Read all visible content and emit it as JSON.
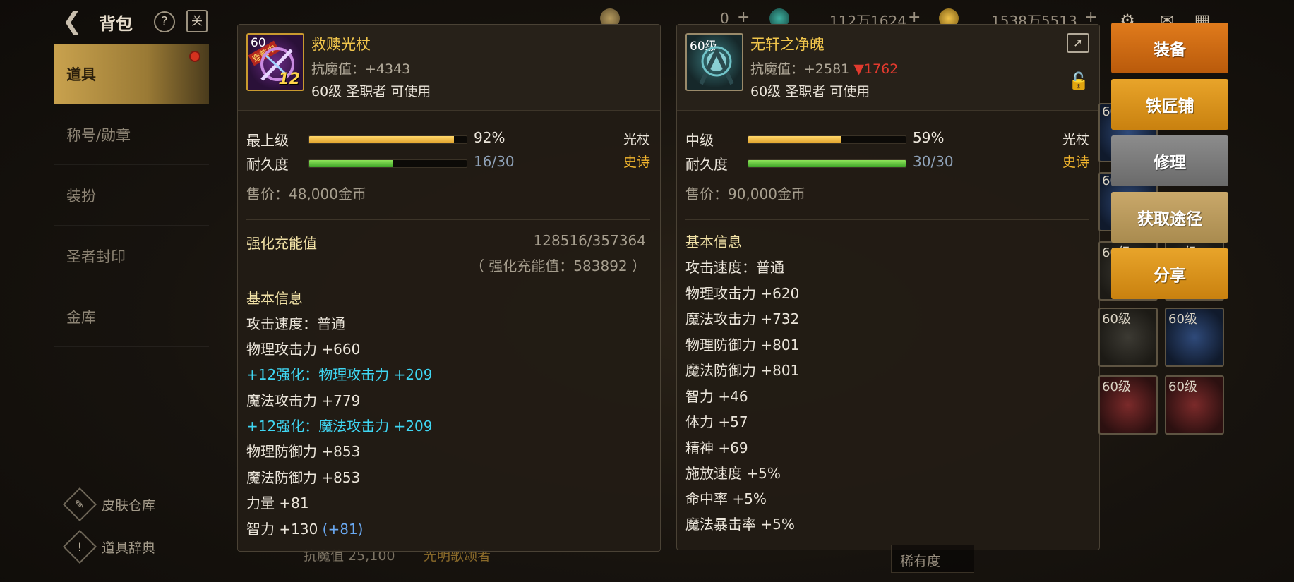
{
  "topbar": {
    "title": "背包",
    "help": "?",
    "book": "关",
    "currency": [
      {
        "value": "0",
        "plus": "+"
      },
      {
        "value": "112万1624",
        "plus": "+"
      },
      {
        "value": "1538万5513",
        "plus": "+"
      }
    ]
  },
  "sidebar": {
    "items": [
      {
        "label": "道具",
        "active": true
      },
      {
        "label": "称号/勋章"
      },
      {
        "label": "装扮"
      },
      {
        "label": "圣者封印"
      },
      {
        "label": "金库"
      }
    ],
    "bottom": [
      {
        "label": "皮肤仓库",
        "icon": "brush-icon"
      },
      {
        "label": "道具辞典",
        "icon": "book-icon"
      }
    ]
  },
  "background": {
    "mres_text": "抗魔值 25,100",
    "title_text": "光明歌颂者",
    "rarity_filter": "稀有度"
  },
  "left_card": {
    "level_tag": "60",
    "equipped_tag": "穿戴中",
    "enhance": "12",
    "name": "救赎光杖",
    "magic_resist": "抗魔值：+4343",
    "usable": "60级 圣职者 可使用",
    "grade_label": "最上级",
    "grade_pct_value": 0.92,
    "grade_pct": "92%",
    "type": "光杖",
    "rarity": "史诗",
    "durability_label": "耐久度",
    "durability_value": 0.533,
    "durability": "16/30",
    "price": "售价：48,000金币",
    "charge_label": "强化充能值",
    "charge_value": "128516/357364",
    "charge_total": "（ 强化充能值：583892 ）",
    "basic_info": "基本信息",
    "stats": [
      {
        "text": "攻击速度：普通",
        "style": "normal"
      },
      {
        "text": "物理攻击力 +660",
        "style": "normal"
      },
      {
        "text": "+12强化：物理攻击力 +209",
        "style": "cyan"
      },
      {
        "text": "魔法攻击力 +779",
        "style": "normal"
      },
      {
        "text": "+12强化：魔法攻击力 +209",
        "style": "cyan"
      },
      {
        "text": "物理防御力 +853",
        "style": "normal"
      },
      {
        "text": "魔法防御力 +853",
        "style": "normal"
      },
      {
        "text": "力量 +81",
        "style": "normal"
      },
      {
        "text": "智力 +130",
        "style": "normal",
        "extra": "(+81)"
      }
    ]
  },
  "right_card": {
    "level_tag": "60级",
    "name": "无轩之净魄",
    "magic_resist": "抗魔值：+2581",
    "mres_diff": "▼1762",
    "usable": "60级 圣职者 可使用",
    "grade_label": "中级",
    "grade_pct_value": 0.59,
    "grade_pct": "59%",
    "type": "光杖",
    "rarity": "史诗",
    "durability_label": "耐久度",
    "durability_value": 1.0,
    "durability": "30/30",
    "price": "售价：90,000金币",
    "basic_info": "基本信息",
    "stats": [
      "攻击速度：普通",
      "物理攻击力 +620",
      "魔法攻击力 +732",
      "物理防御力 +801",
      "魔法防御力 +801",
      "智力 +46",
      "体力 +57",
      "精神 +69",
      "施放速度 +5%",
      "命中率 +5%",
      "魔法暴击率 +5%"
    ]
  },
  "actions": [
    {
      "label": "装备",
      "style": "dark-orange"
    },
    {
      "label": "铁匠铺",
      "style": "gold"
    },
    {
      "label": "修理",
      "style": "grey"
    },
    {
      "label": "获取途径",
      "style": "tan"
    },
    {
      "label": "分享",
      "style": "gold"
    }
  ],
  "inventory": {
    "slots": [
      {
        "level": "60",
        "color": "blue"
      },
      {
        "level": "60",
        "color": "blue"
      },
      {
        "level": "60级",
        "color": "grey"
      },
      {
        "level": "60级",
        "color": "grey"
      },
      {
        "level": "60级",
        "color": "grey"
      },
      {
        "level": "60级",
        "color": "blue"
      },
      {
        "level": "60级",
        "color": "red"
      },
      {
        "level": "60级",
        "color": "red"
      }
    ]
  }
}
